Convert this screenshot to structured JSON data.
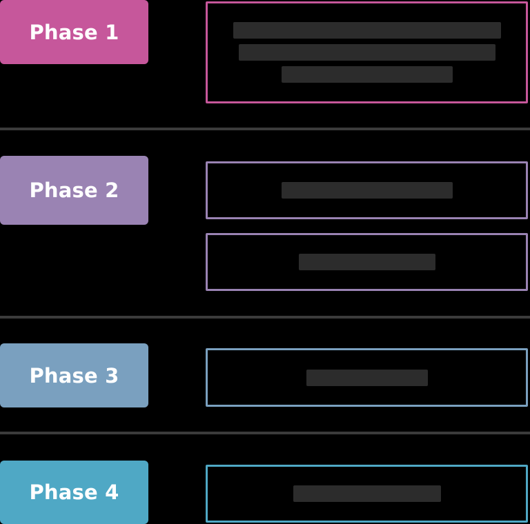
{
  "phases": [
    {
      "label": "Phase 1",
      "color": "#c6579b",
      "tasks": [
        ""
      ]
    },
    {
      "label": "Phase 2",
      "color": "#9a83b3",
      "tasks": [
        "",
        ""
      ]
    },
    {
      "label": "Phase 3",
      "color": "#7aa0bf",
      "tasks": [
        ""
      ]
    },
    {
      "label": "Phase 4",
      "color": "#4fa8c5",
      "tasks": [
        ""
      ]
    }
  ],
  "colors": {
    "background": "#000000",
    "divider": "#3b3b3b",
    "redacted_text": "#2c2c2c"
  }
}
